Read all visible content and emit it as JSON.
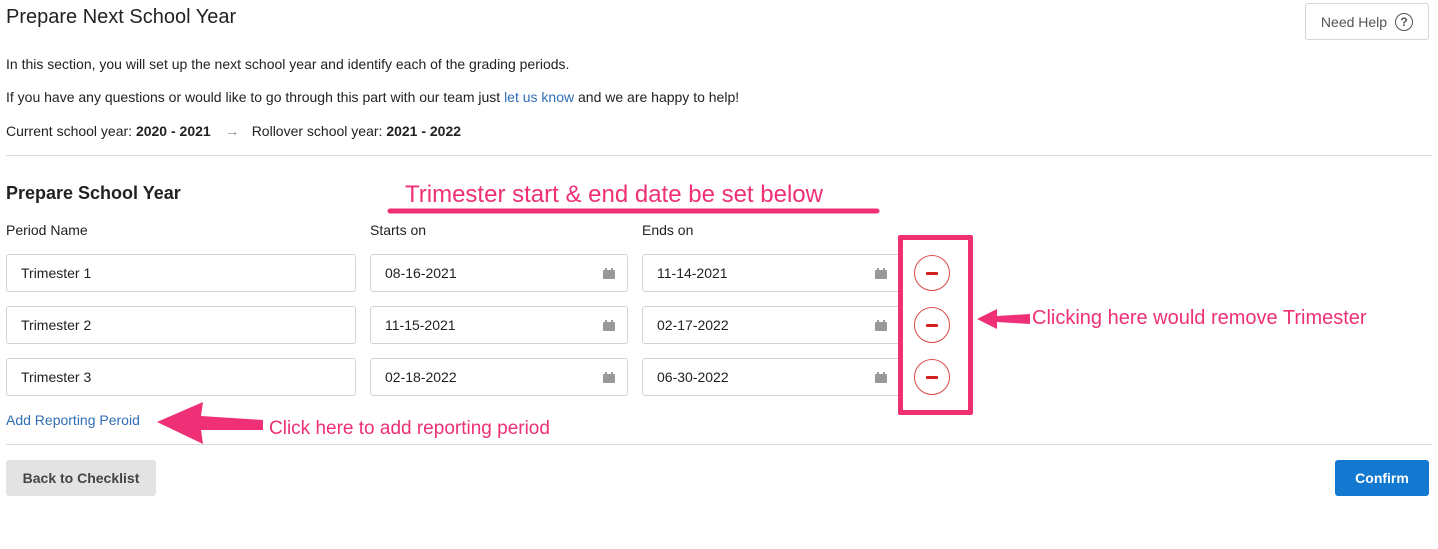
{
  "page": {
    "title": "Prepare Next School Year",
    "help_label": "Need Help",
    "help_icon": "question-circle-icon",
    "intro_line1": "In this section, you will set up the next school year and identify each of the grading periods.",
    "intro_line2_before": "If you have any questions or would like to go through this part with our team just ",
    "intro_line2_link": "let us know",
    "intro_line2_after": " and we are happy to help!",
    "current_year_label": "Current school year: ",
    "current_year_value": "2020 - 2021",
    "arrow": "→",
    "rollover_year_label": "Rollover school year: ",
    "rollover_year_value": "2021 - 2022"
  },
  "prepare": {
    "section_title": "Prepare School Year",
    "columns": {
      "name": "Period Name",
      "start": "Starts on",
      "end": "Ends on"
    },
    "periods": [
      {
        "name": "Trimester 1",
        "start": "08-16-2021",
        "end": "11-14-2021"
      },
      {
        "name": "Trimester 2",
        "start": "11-15-2021",
        "end": "02-17-2022"
      },
      {
        "name": "Trimester 3",
        "start": "02-18-2022",
        "end": "06-30-2022"
      }
    ],
    "add_link": "Add Reporting Peroid"
  },
  "footer": {
    "back_label": "Back to Checklist",
    "confirm_label": "Confirm"
  },
  "annotations": {
    "top": "Trimester start & end date be set below",
    "remove": "Clicking here would remove Trimester",
    "add": "Click here to add reporting period",
    "color": "#ef2f76"
  },
  "colors": {
    "link": "#2f6db5",
    "confirm": "#1278d0",
    "remove": "#d01f1f"
  }
}
